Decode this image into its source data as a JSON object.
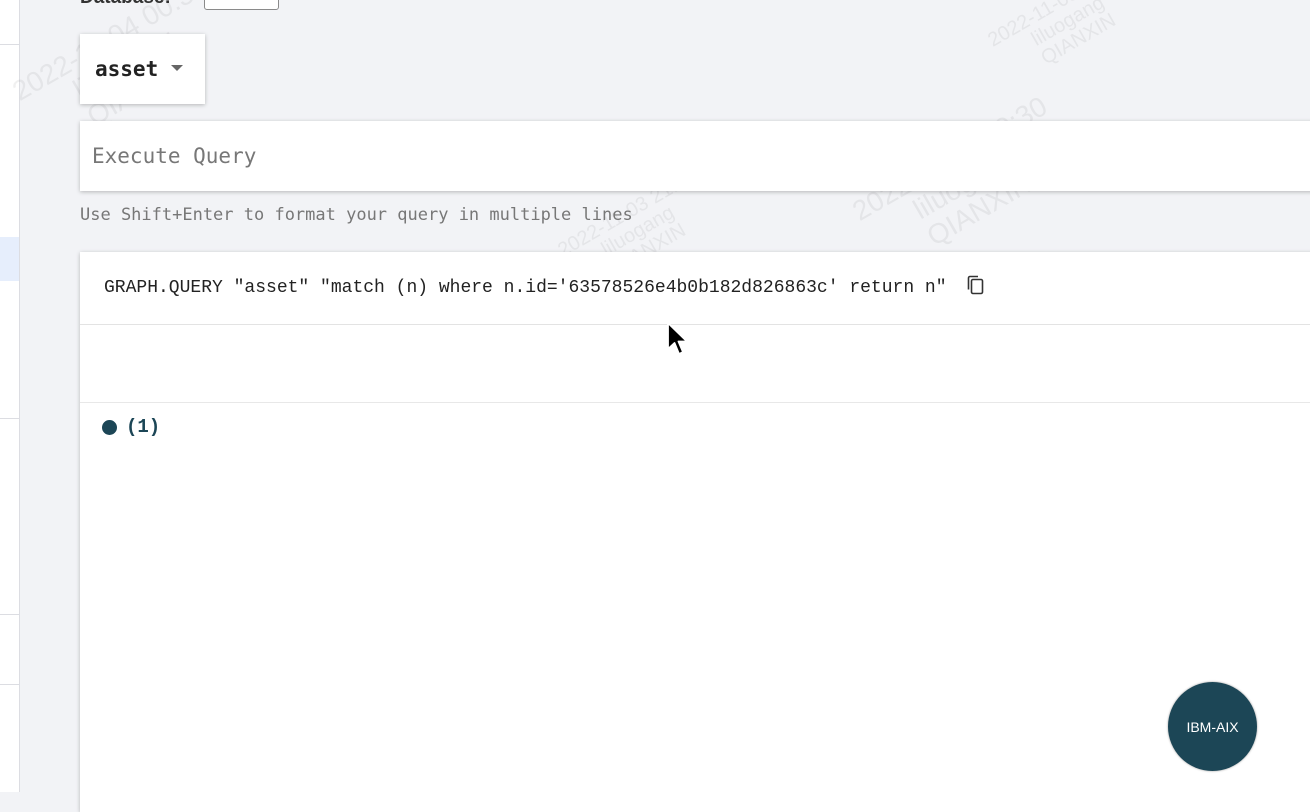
{
  "database": {
    "label": "Database:",
    "value": ""
  },
  "graph_selector": {
    "selected": "asset",
    "icon": "caret-down-icon"
  },
  "query": {
    "placeholder": "Execute Query",
    "hint": "Use Shift+Enter to format your query in multiple lines"
  },
  "result": {
    "query_text": "GRAPH.QUERY \"asset\" \"match (n) where n.id='63578526e4b0b182d826863c' return n\"",
    "copy_icon": "copy-icon",
    "legend_count": "(1)",
    "node_label": "IBM-AIX",
    "node_color": "#1c4656"
  },
  "watermarks": [
    {
      "date": "2022-11-04 00:30",
      "user": "liluogang",
      "org": "QIANXIN"
    },
    {
      "date": "2022-11-03 21:44",
      "user": "liluogang",
      "org": "QIANXIN"
    }
  ]
}
